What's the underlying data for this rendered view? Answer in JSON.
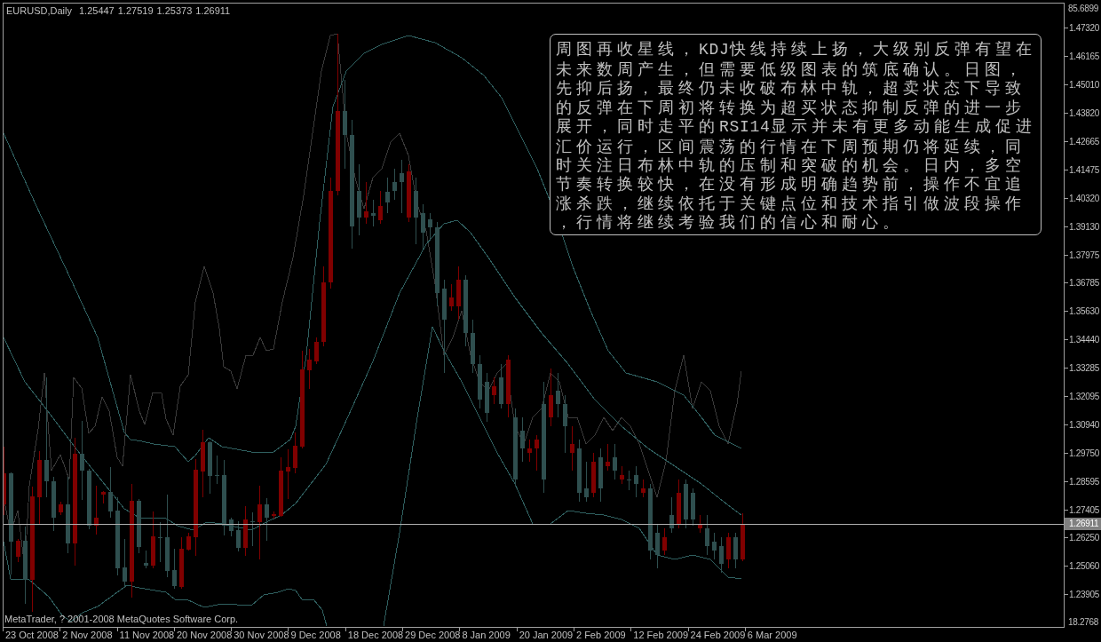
{
  "chart_header": {
    "symbol": "EURUSD,Daily",
    "ohlc": [
      "1.25447",
      "1.27519",
      "1.25373",
      "1.26911"
    ]
  },
  "comment_box": {
    "text": "周图再收星线，KDJ快线持续上扬，大级别反弹有望在未来数周产生，但需要低级图表的筑底确认。日图，先抑后扬，最终仍未收破布林中轨，超卖状态下导致的反弹在下周初将转换为超买状态抑制反弹的进一步展开，同时走平的RSI14显示并未有更多动能生成促进汇价运行，区间震荡的行情在下周预期仍将延续，同时关注日布林中轨的压制和突破的机会。日内，多空节奏转换较快，在没有形成明确趋势前，操作不宜追涨杀跌，继续依托于关键点位和技术指引做波段操作，行情将继续考验我们的信心和耐心。"
  },
  "copyright": "MetaTrader, ? 2001-2008 MetaQuotes Software Corp.",
  "price_axis": {
    "indicator_max": "85.6899",
    "labels": [
      "1.47320",
      "1.46165",
      "1.45010",
      "1.43820",
      "1.42665",
      "1.41475",
      "1.40320",
      "1.39130",
      "1.37975",
      "1.36785",
      "1.35630",
      "1.34440",
      "1.33285",
      "1.32095",
      "1.30940",
      "1.29750",
      "1.28595",
      "1.27405",
      "1.26250",
      "1.25060",
      "1.23905"
    ],
    "current_price": "1.26911",
    "indicator_min": "18.2768"
  },
  "time_axis": {
    "labels": [
      "23 Oct 2008",
      "2 Nov 2008",
      "11 Nov 2008",
      "20 Nov 2008",
      "30 Nov 2008",
      "9 Dec 2008",
      "18 Dec 2008",
      "29 Dec 2008",
      "8 Jan 2009",
      "20 Jan 2009",
      "2 Feb 2009",
      "12 Feb 2009",
      "24 Feb 2009",
      "6 Mar 2009"
    ]
  }
}
